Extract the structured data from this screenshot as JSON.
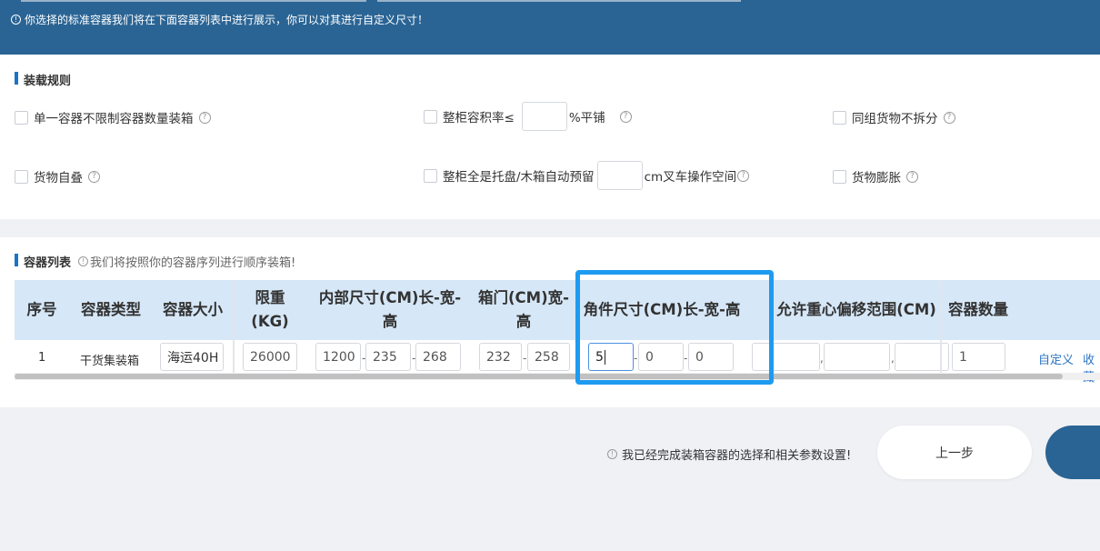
{
  "banner": {
    "notice": "你选择的标准容器我们将在下面容器列表中进行展示，你可以对其进行自定义尺寸！",
    "bg_color": "#2a6494"
  },
  "rules": {
    "title": "装载规则",
    "items": [
      {
        "label": "单一容器不限制容器数量装箱"
      },
      {
        "label": "整柜容积率≤",
        "suffix": "%平铺",
        "value": ""
      },
      {
        "label": "同组货物不拆分"
      },
      {
        "label": "货物自叠"
      },
      {
        "label": "整柜全是托盘/木箱自动预留",
        "suffix": "cm叉车操作空间",
        "value": ""
      },
      {
        "label": "货物膨胀"
      }
    ]
  },
  "containers": {
    "title": "容器列表",
    "hint": "我们将按照你的容器序列进行顺序装箱!",
    "headers": {
      "index": "序号",
      "type": "容器类型",
      "size": "容器大小",
      "weight": "限重(KG)",
      "inner": "内部尺寸(CM)长-宽-高",
      "door": "箱门(CM)宽-高",
      "corner": "角件尺寸(CM)长-宽-高",
      "offset": "允许重心偏移范围(CM)",
      "qty": "容器数量"
    },
    "row": {
      "index": "1",
      "type": "干货集装箱",
      "size": "海运40H",
      "weight": "26000",
      "inner_l": "1200",
      "inner_w": "235",
      "inner_h": "268",
      "door_w": "232",
      "door_h": "258",
      "corner_l": "5",
      "corner_w": "0",
      "corner_h": "0",
      "offset_1": "",
      "offset_2": "",
      "offset_3": "",
      "qty": "1",
      "custom_link": "自定义",
      "save_link": "收藏"
    },
    "highlight_color": "#1e9bf0"
  },
  "footer": {
    "hint": "我已经完成装箱容器的选择和相关参数设置!",
    "prev_label": "上一步"
  }
}
